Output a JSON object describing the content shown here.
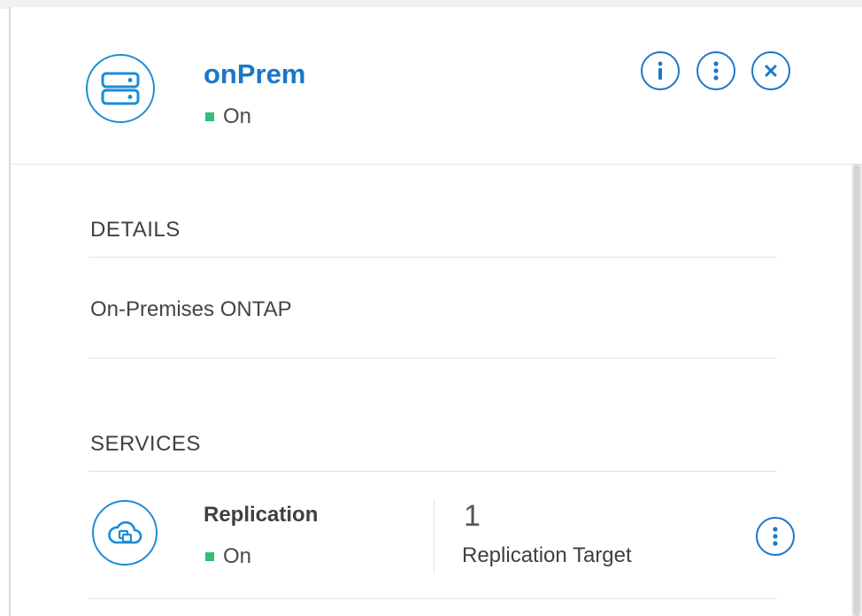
{
  "header": {
    "title": "onPrem",
    "status": "On",
    "icon": "server-icon"
  },
  "actions": [
    {
      "name": "info",
      "icon": "info-icon"
    },
    {
      "name": "more",
      "icon": "more-vertical-icon"
    },
    {
      "name": "close",
      "icon": "close-icon"
    }
  ],
  "details": {
    "title": "DETAILS",
    "text": "On-Premises ONTAP"
  },
  "services": {
    "title": "SERVICES",
    "items": [
      {
        "name": "Replication",
        "status": "On",
        "count": "1",
        "count_label": "Replication Target",
        "icon": "cloud-replication-icon"
      }
    ]
  },
  "colors": {
    "accent": "#1a77c9",
    "status_on": "#2fbf7a",
    "text": "#404040",
    "divider": "#e2e2e2"
  }
}
